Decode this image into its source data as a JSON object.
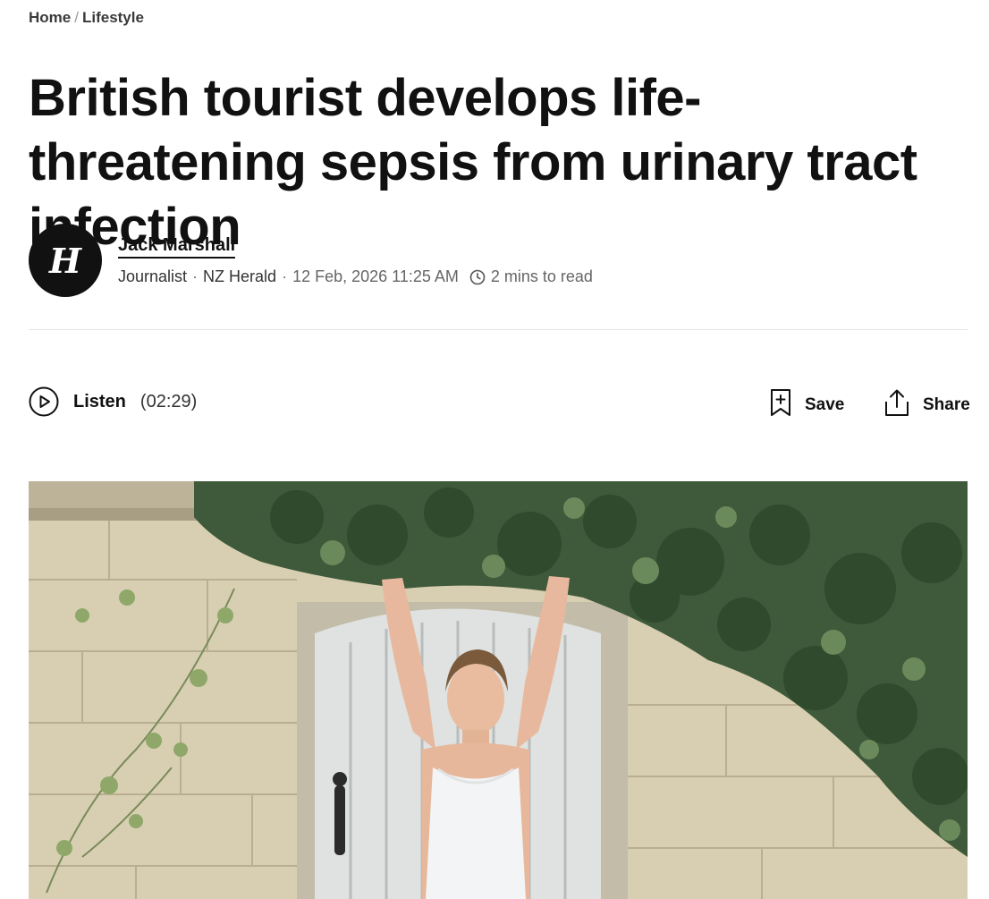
{
  "breadcrumb": {
    "home": "Home",
    "separator": "/",
    "section": "Lifestyle"
  },
  "article": {
    "headline": "British tourist develops life-threatening sepsis from urinary tract infection",
    "author": {
      "avatar_letter": "H",
      "name": "Jack Marshall",
      "role": "Journalist",
      "publication": "NZ Herald",
      "date": "12 Feb, 2026 11:25 AM",
      "read_time": "2 mins to read"
    }
  },
  "toolbar": {
    "listen_label": "Listen",
    "listen_duration": "(02:29)",
    "save_label": "Save",
    "share_label": "Share"
  },
  "icons": {
    "play": "play-circle-icon",
    "clock": "clock-icon",
    "save": "bookmark-plus-icon",
    "share": "share-upload-icon"
  },
  "colors": {
    "text": "#111111",
    "muted": "#666666",
    "divider": "#e3e3e3",
    "avatar_bg": "#111111"
  }
}
